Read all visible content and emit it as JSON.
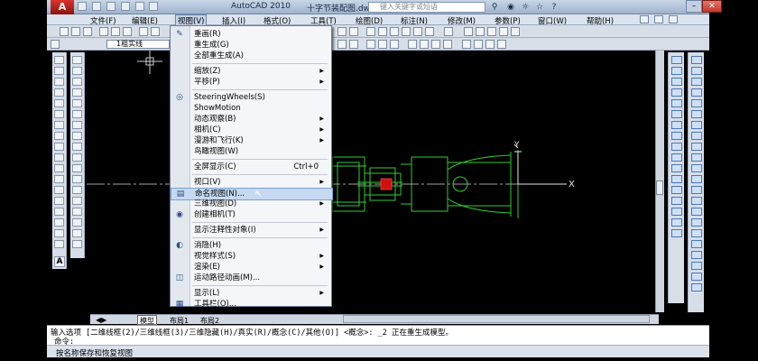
{
  "title_bar": {
    "logo": "A",
    "app_name": "AutoCAD 2010",
    "document": "十字节装配图.dwg",
    "search_placeholder": "键入关键字或短语"
  },
  "menubar": {
    "items": [
      "文件(F)",
      "编辑(E)",
      "视图(V)",
      "插入(I)",
      "格式(O)",
      "工具(T)",
      "绘图(D)",
      "标注(N)",
      "修改(M)",
      "参数(P)",
      "窗口(W)",
      "帮助(H)"
    ]
  },
  "layer_combo": "1粗实线",
  "view_menu": {
    "items": [
      {
        "label": "重画(R)",
        "icon": "brush-icon"
      },
      {
        "label": "重生成(G)"
      },
      {
        "label": "全部重生成(A)"
      },
      {
        "separator": true
      },
      {
        "label": "缩放(Z)",
        "submenu": true
      },
      {
        "label": "平移(P)",
        "submenu": true
      },
      {
        "separator": true
      },
      {
        "label": "SteeringWheels(S)",
        "icon": "steering-wheel-icon"
      },
      {
        "label": "ShowMotion"
      },
      {
        "label": "动态观察(B)",
        "submenu": true
      },
      {
        "label": "相机(C)",
        "submenu": true
      },
      {
        "label": "漫游和飞行(K)",
        "submenu": true
      },
      {
        "label": "鸟瞰视图(W)"
      },
      {
        "separator": true
      },
      {
        "label": "全屏显示(C)",
        "shortcut": "Ctrl+0"
      },
      {
        "separator": true
      },
      {
        "label": "视口(V)",
        "submenu": true
      },
      {
        "label": "命名视图(N)...",
        "icon": "named-view-icon",
        "highlighted": true
      },
      {
        "label": "三维视图(D)",
        "submenu": true
      },
      {
        "label": "创建相机(T)",
        "icon": "camera-icon"
      },
      {
        "separator": true
      },
      {
        "label": "显示注释性对象(I)",
        "submenu": true
      },
      {
        "separator": true
      },
      {
        "label": "消隐(H)",
        "icon": "hide-icon"
      },
      {
        "label": "视觉样式(S)",
        "submenu": true
      },
      {
        "label": "渲染(E)",
        "submenu": true
      },
      {
        "label": "运动路径动画(M)...",
        "icon": "motion-path-icon"
      },
      {
        "separator": true
      },
      {
        "label": "显示(L)",
        "submenu": true
      },
      {
        "label": "工具栏(O)...",
        "icon": "toolbar-icon"
      }
    ]
  },
  "tabs": {
    "model": "模型",
    "layout1": "布局1",
    "layout2": "布局2"
  },
  "command_line": {
    "line1": "输入选项 [二维线框(2)/三维线框(3)/三维隐藏(H)/真实(R)/概念(C)/其他(O)] <概念>: _2 正在重生成模型。",
    "line2": "命令:"
  },
  "status_bar": {
    "text": "按名称保存和恢复视图"
  },
  "drawing": {
    "ucs_y": "Y",
    "ucs_x": "X",
    "line_color": "#32cd32",
    "center_color": "#e0e0e0",
    "hatch_color": "#ff2020"
  }
}
